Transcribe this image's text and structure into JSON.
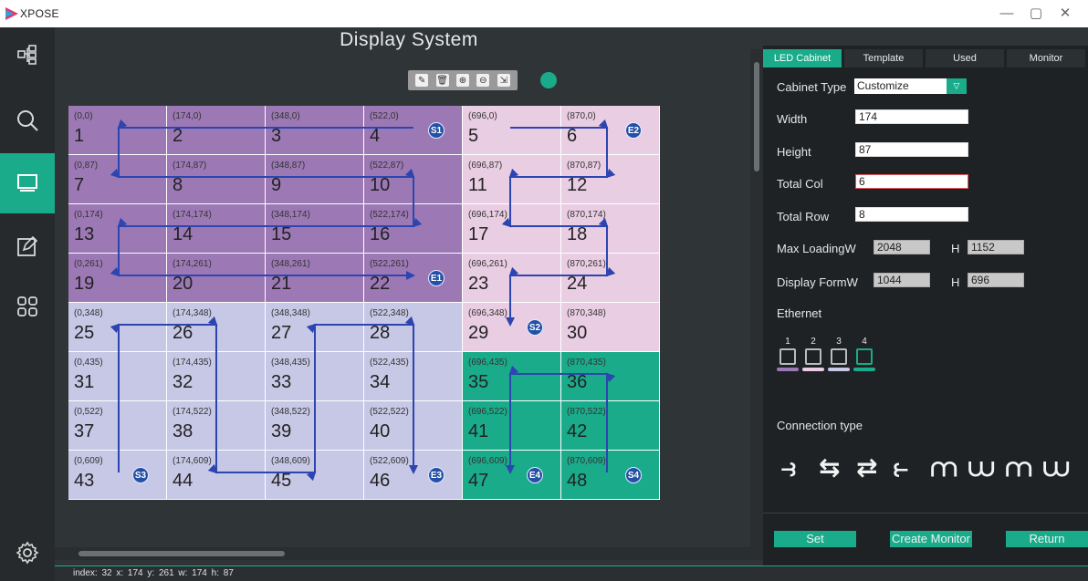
{
  "window": {
    "title": "XPOSE",
    "controls": [
      "—",
      "▢",
      "✕"
    ]
  },
  "sidebar": {
    "items": [
      {
        "icon": "topology-icon",
        "active": false
      },
      {
        "icon": "search-icon",
        "active": false
      },
      {
        "icon": "display-icon",
        "active": true
      },
      {
        "icon": "edit-icon",
        "active": false
      },
      {
        "icon": "apps-icon",
        "active": false
      },
      {
        "icon": "settings-icon",
        "active": false
      }
    ]
  },
  "main": {
    "title": "Display System",
    "toolbar": [
      {
        "icon": "eraser-icon",
        "glyph": "✎"
      },
      {
        "icon": "trash-icon",
        "glyph": "🗑"
      },
      {
        "icon": "zoom-in-icon",
        "glyph": "⊕"
      },
      {
        "icon": "zoom-out-icon",
        "glyph": "⊖"
      },
      {
        "icon": "fit-icon",
        "glyph": "⇲"
      }
    ],
    "grid": {
      "cols": 6,
      "rows": 8,
      "colors": {
        "purple": "#9c79b5",
        "pink": "#e9cde2",
        "lavender": "#c7c7e6",
        "teal": "#1aab8b"
      },
      "cells": [
        {
          "num": "1",
          "coord": "(0,0)",
          "color": "purple"
        },
        {
          "num": "2",
          "coord": "(174,0)",
          "color": "purple"
        },
        {
          "num": "3",
          "coord": "(348,0)",
          "color": "purple"
        },
        {
          "num": "4",
          "coord": "(522,0)",
          "color": "purple"
        },
        {
          "num": "5",
          "coord": "(696,0)",
          "color": "pink"
        },
        {
          "num": "6",
          "coord": "(870,0)",
          "color": "pink"
        },
        {
          "num": "7",
          "coord": "(0,87)",
          "color": "purple"
        },
        {
          "num": "8",
          "coord": "(174,87)",
          "color": "purple"
        },
        {
          "num": "9",
          "coord": "(348,87)",
          "color": "purple"
        },
        {
          "num": "10",
          "coord": "(522,87)",
          "color": "purple"
        },
        {
          "num": "11",
          "coord": "(696,87)",
          "color": "pink"
        },
        {
          "num": "12",
          "coord": "(870,87)",
          "color": "pink"
        },
        {
          "num": "13",
          "coord": "(0,174)",
          "color": "purple"
        },
        {
          "num": "14",
          "coord": "(174,174)",
          "color": "purple"
        },
        {
          "num": "15",
          "coord": "(348,174)",
          "color": "purple"
        },
        {
          "num": "16",
          "coord": "(522,174)",
          "color": "purple"
        },
        {
          "num": "17",
          "coord": "(696,174)",
          "color": "pink"
        },
        {
          "num": "18",
          "coord": "(870,174)",
          "color": "pink"
        },
        {
          "num": "19",
          "coord": "(0,261)",
          "color": "purple"
        },
        {
          "num": "20",
          "coord": "(174,261)",
          "color": "purple"
        },
        {
          "num": "21",
          "coord": "(348,261)",
          "color": "purple"
        },
        {
          "num": "22",
          "coord": "(522,261)",
          "color": "purple"
        },
        {
          "num": "23",
          "coord": "(696,261)",
          "color": "pink"
        },
        {
          "num": "24",
          "coord": "(870,261)",
          "color": "pink"
        },
        {
          "num": "25",
          "coord": "(0,348)",
          "color": "lavender"
        },
        {
          "num": "26",
          "coord": "(174,348)",
          "color": "lavender"
        },
        {
          "num": "27",
          "coord": "(348,348)",
          "color": "lavender"
        },
        {
          "num": "28",
          "coord": "(522,348)",
          "color": "lavender"
        },
        {
          "num": "29",
          "coord": "(696,348)",
          "color": "pink"
        },
        {
          "num": "30",
          "coord": "(870,348)",
          "color": "pink"
        },
        {
          "num": "31",
          "coord": "(0,435)",
          "color": "lavender"
        },
        {
          "num": "32",
          "coord": "(174,435)",
          "color": "lavender"
        },
        {
          "num": "33",
          "coord": "(348,435)",
          "color": "lavender"
        },
        {
          "num": "34",
          "coord": "(522,435)",
          "color": "lavender"
        },
        {
          "num": "35",
          "coord": "(696,435)",
          "color": "teal"
        },
        {
          "num": "36",
          "coord": "(870,435)",
          "color": "teal"
        },
        {
          "num": "37",
          "coord": "(0,522)",
          "color": "lavender"
        },
        {
          "num": "38",
          "coord": "(174,522)",
          "color": "lavender"
        },
        {
          "num": "39",
          "coord": "(348,522)",
          "color": "lavender"
        },
        {
          "num": "40",
          "coord": "(522,522)",
          "color": "lavender"
        },
        {
          "num": "41",
          "coord": "(696,522)",
          "color": "teal"
        },
        {
          "num": "42",
          "coord": "(870,522)",
          "color": "teal"
        },
        {
          "num": "43",
          "coord": "(0,609)",
          "color": "lavender"
        },
        {
          "num": "44",
          "coord": "(174,609)",
          "color": "lavender"
        },
        {
          "num": "45",
          "coord": "(348,609)",
          "color": "lavender"
        },
        {
          "num": "46",
          "coord": "(522,609)",
          "color": "lavender"
        },
        {
          "num": "47",
          "coord": "(696,609)",
          "color": "teal"
        },
        {
          "num": "48",
          "coord": "(870,609)",
          "color": "teal"
        }
      ],
      "badges": [
        {
          "label": "S1",
          "cell": "4"
        },
        {
          "label": "E2",
          "cell": "6"
        },
        {
          "label": "E1",
          "cell": "22"
        },
        {
          "label": "S2",
          "cell": "29"
        },
        {
          "label": "S3",
          "cell": "43"
        },
        {
          "label": "E3",
          "cell": "46"
        },
        {
          "label": "E4",
          "cell": "47"
        },
        {
          "label": "S4",
          "cell": "48"
        }
      ]
    }
  },
  "panel": {
    "tabs": [
      "LED Cabinet",
      "Template",
      "Used",
      "Monitor"
    ],
    "active_tab": "LED Cabinet",
    "cabinet_type_label": "Cabinet Type",
    "cabinet_type_value": "Customize",
    "width_label": "Width",
    "width_value": "174",
    "height_label": "Height",
    "height_value": "87",
    "total_col_label": "Total  Col",
    "total_col_value": "6",
    "total_row_label": "Total Row",
    "total_row_value": "8",
    "max_loading_label": "Max LoadingW",
    "max_loading_w": "2048",
    "h_label": "H",
    "max_loading_h": "1152",
    "display_format_label": "Display FormW",
    "display_format_w": "1044",
    "display_format_h": "696",
    "ethernet_label": "Ethernet",
    "ethernet_ports": [
      {
        "num": "1",
        "color": "#9c79b5"
      },
      {
        "num": "2",
        "color": "#e9cde2"
      },
      {
        "num": "3",
        "color": "#c7c7e6"
      },
      {
        "num": "4",
        "color": "#1aab8b"
      }
    ],
    "connection_type_label": "Connection type",
    "connection_types": [
      "⥽",
      "⇆",
      "⇄",
      "⥼",
      "⩋",
      "⩊",
      "⩋",
      "⩊"
    ],
    "set_button": "Set",
    "create_monitor_button": "Create Monitor",
    "return_button": "Return"
  },
  "status": {
    "text": "index:  32   x:  174   y:  261   w:  174   h:  87"
  }
}
